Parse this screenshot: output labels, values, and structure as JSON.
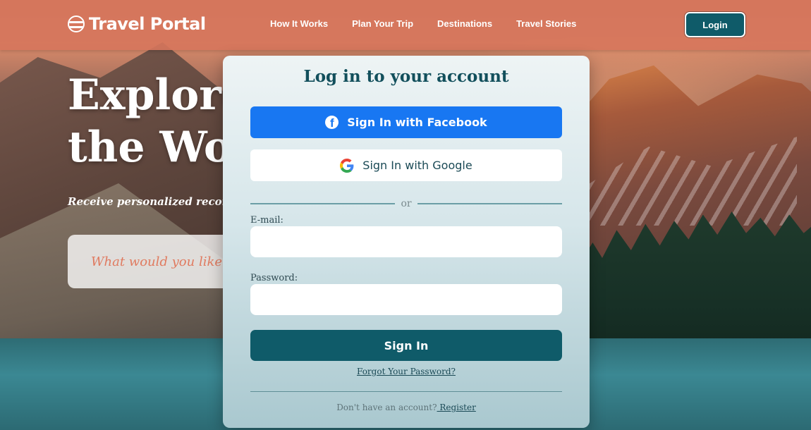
{
  "header": {
    "logo_text": "Travel Portal",
    "nav": [
      {
        "label": "How It Works"
      },
      {
        "label": "Plan Your Trip"
      },
      {
        "label": "Destinations"
      },
      {
        "label": "Travel Stories"
      }
    ],
    "login_label": "Login"
  },
  "hero": {
    "title": "Explore\nthe Wo",
    "subtitle": "Receive personalized recomme",
    "search_placeholder": "What would you like to"
  },
  "modal": {
    "title": "Log in to your account",
    "facebook_label": "Sign In with Facebook",
    "google_label": "Sign In with Google",
    "divider_text": "or",
    "email_label": "E-mail:",
    "email_value": "",
    "password_label": "Password:",
    "password_value": "",
    "signin_label": "Sign In",
    "forgot_label": "Forgot Your Password?",
    "register_prompt": "Don't have an account?",
    "register_label": " Register"
  },
  "colors": {
    "header_bg": "#d6765c",
    "primary": "#0f5b69",
    "facebook": "#1877f2",
    "accent_text": "#e07a5f"
  }
}
